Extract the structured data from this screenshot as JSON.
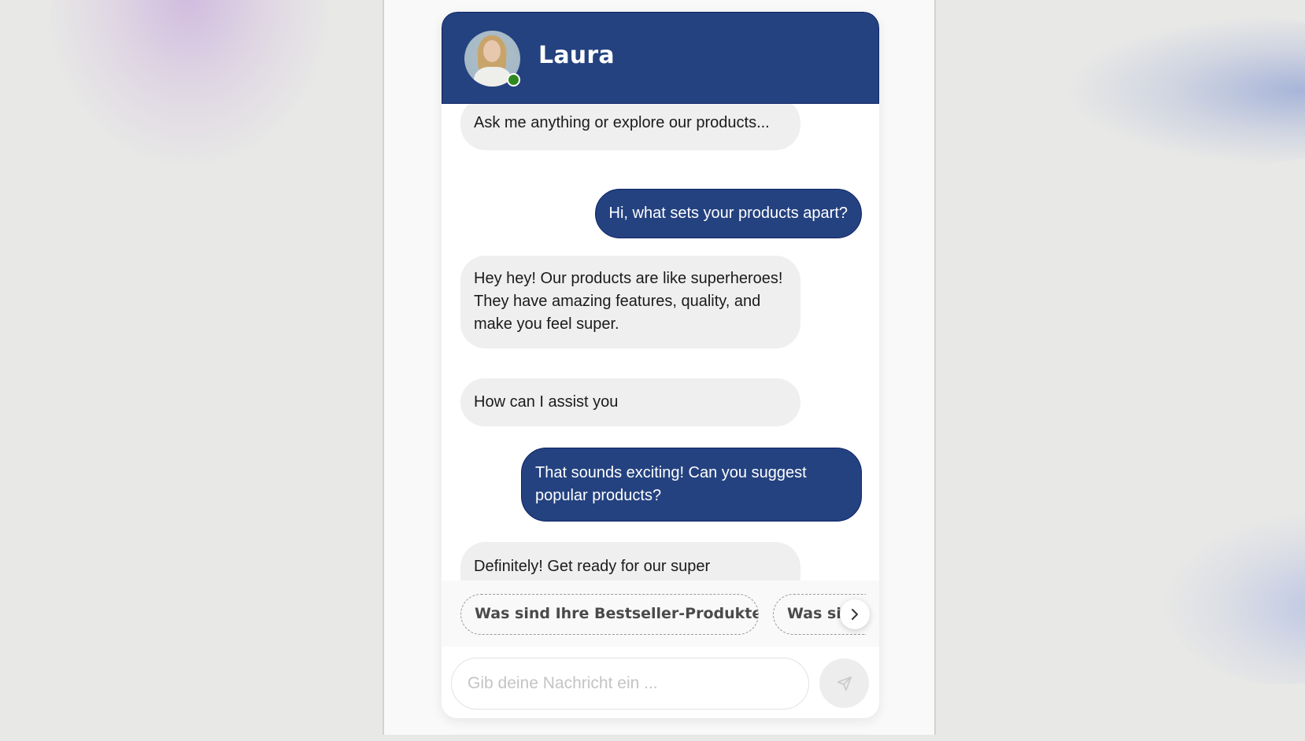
{
  "header": {
    "agent_name": "Laura",
    "status": "online",
    "status_color": "#2e8a1e",
    "brand_color": "#244280"
  },
  "messages": [
    {
      "sender": "bot",
      "text": "Ask me anything or explore our products..."
    },
    {
      "sender": "user",
      "text": "Hi, what sets your products apart?"
    },
    {
      "sender": "bot",
      "text": "Hey hey! Our products are like superheroes! They have amazing features, quality, and make you feel super."
    },
    {
      "sender": "bot",
      "text": "How can I assist you"
    },
    {
      "sender": "user",
      "text": "That sounds exciting! Can you suggest popular products?"
    },
    {
      "sender": "bot",
      "text": "Definitely! Get ready for our super"
    }
  ],
  "suggestions": {
    "chips": [
      {
        "label": "Was sind Ihre Bestseller-Produkte?"
      },
      {
        "label": "Was sind"
      }
    ],
    "next_icon": "chevron-right-icon"
  },
  "composer": {
    "placeholder": "Gib deine Nachricht ein ...",
    "value": "",
    "send_icon": "send-icon"
  }
}
